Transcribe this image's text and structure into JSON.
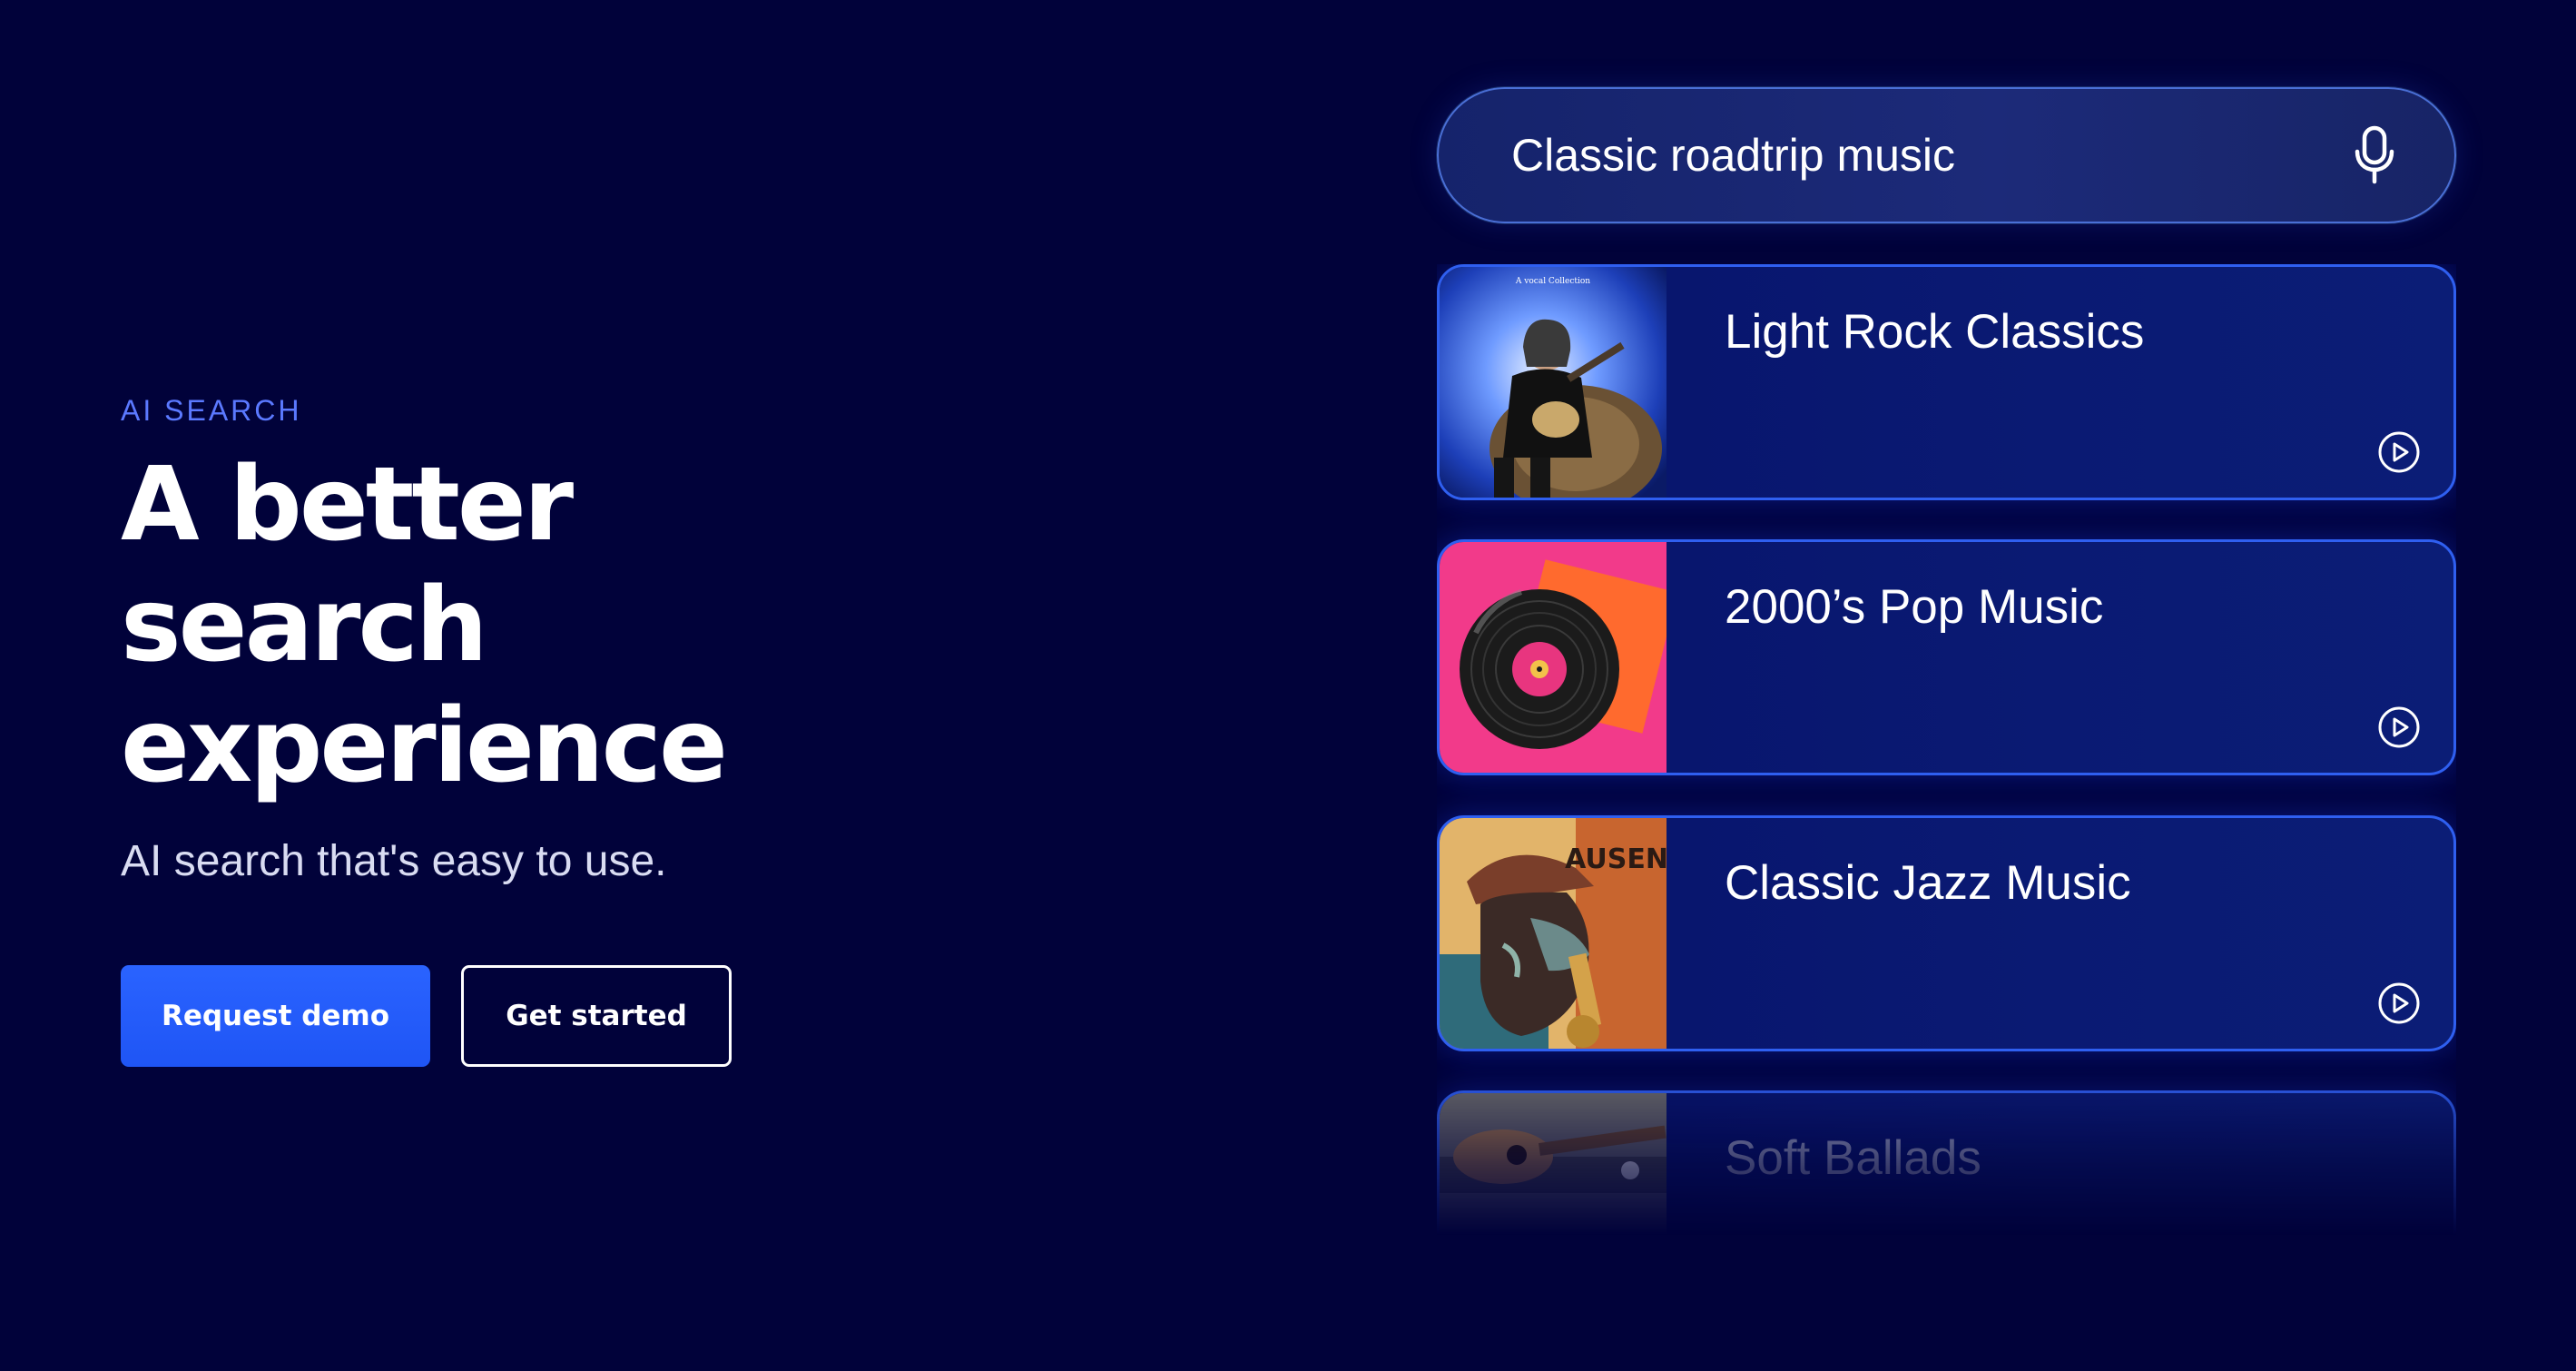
{
  "hero": {
    "eyebrow": "AI SEARCH",
    "headline": "A better search experience",
    "subtitle": "AI search that's easy to use.",
    "primary_button": "Request demo",
    "secondary_button": "Get started"
  },
  "search": {
    "value": "Classic roadtrip music",
    "mic_icon": "microphone-icon"
  },
  "results": [
    {
      "title": "Light Rock Classics",
      "thumb": "guitarist-album-art",
      "play_icon": "play-icon"
    },
    {
      "title": "2000’s Pop Music",
      "thumb": "vinyl-record-art",
      "play_icon": "play-icon"
    },
    {
      "title": "Classic Jazz Music",
      "thumb": "saxophonist-art",
      "play_icon": "play-icon"
    },
    {
      "title": "Soft Ballads",
      "thumb": "acoustic-guitar-art",
      "play_icon": "play-icon"
    }
  ],
  "colors": {
    "background": "#01023a",
    "accent": "#2a63ff",
    "eyebrow": "#5b79ff",
    "card_border": "#2f5ff0"
  }
}
